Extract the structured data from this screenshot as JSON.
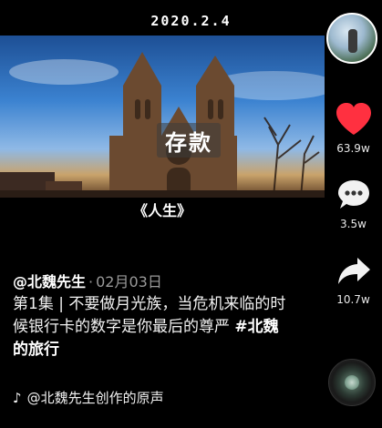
{
  "header": {
    "date": "2020.2.4"
  },
  "video": {
    "overlay_caption": "存款",
    "subtitle": "《人生》"
  },
  "post": {
    "author": "@北魏先生",
    "separator": "·",
    "date": "02月03日",
    "description": "第1集 | 不要做月光族，当危机来临的时候银行卡的数字是你最后的尊严 ",
    "hashtag": "#北魏的旅行",
    "music": "@北魏先生创作的原声"
  },
  "actions": {
    "likes": "63.9w",
    "comments": "3.5w",
    "shares": "10.7w"
  },
  "icons": {
    "like": "heart-icon",
    "comment": "comment-bubble-icon",
    "share": "share-arrow-icon",
    "music": "music-note-icon"
  },
  "colors": {
    "like_red": "#ff3040"
  }
}
